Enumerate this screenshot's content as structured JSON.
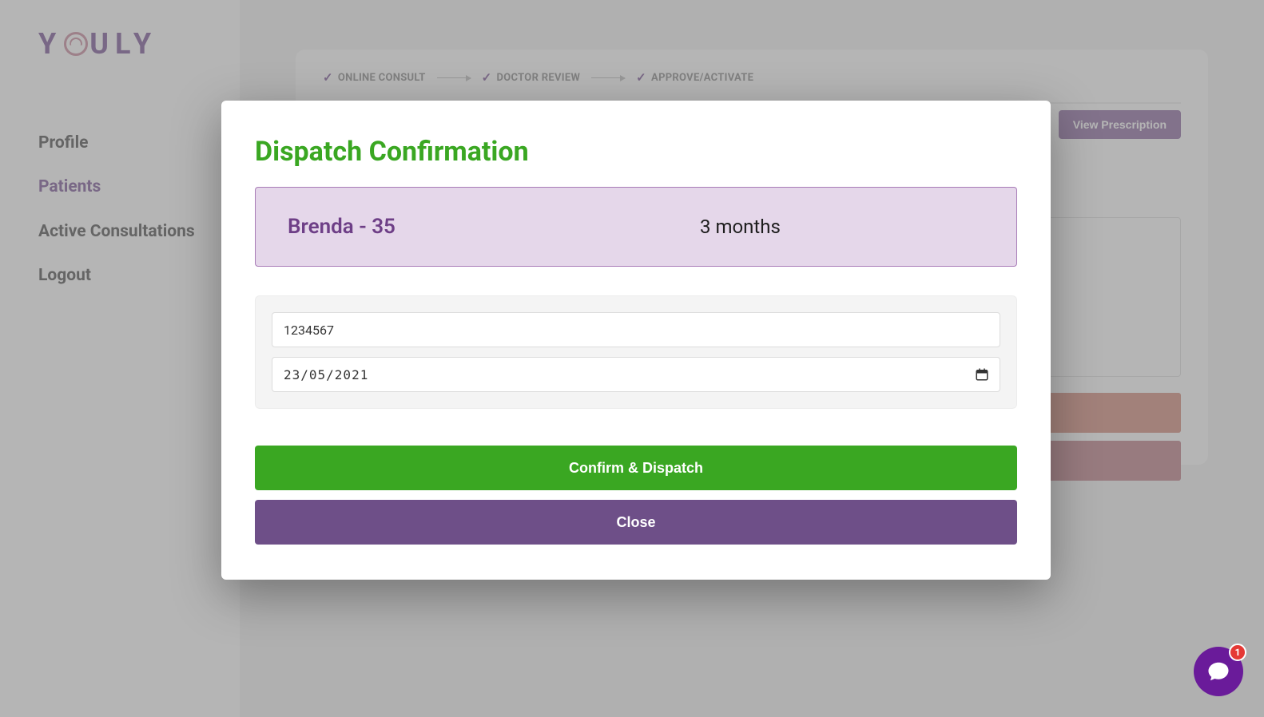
{
  "brand": {
    "name": "YOULY"
  },
  "sidebar": {
    "items": [
      {
        "label": "Profile"
      },
      {
        "label": "Patients"
      },
      {
        "label": "Active Consultations"
      },
      {
        "label": "Logout"
      }
    ]
  },
  "progress": {
    "steps": [
      {
        "label": "ONLINE CONSULT"
      },
      {
        "label": "DOCTOR REVIEW"
      },
      {
        "label": "APPROVE/ACTIVATE"
      }
    ]
  },
  "main": {
    "view_prescription": "View Prescription"
  },
  "modal": {
    "title": "Dispatch Confirmation",
    "patient_name": "Brenda - 35",
    "duration": "3 months",
    "tracking_value": "1234567",
    "date_value": "23/05/2021",
    "confirm_label": "Confirm & Dispatch",
    "close_label": "Close"
  },
  "chat": {
    "unread": "1"
  }
}
